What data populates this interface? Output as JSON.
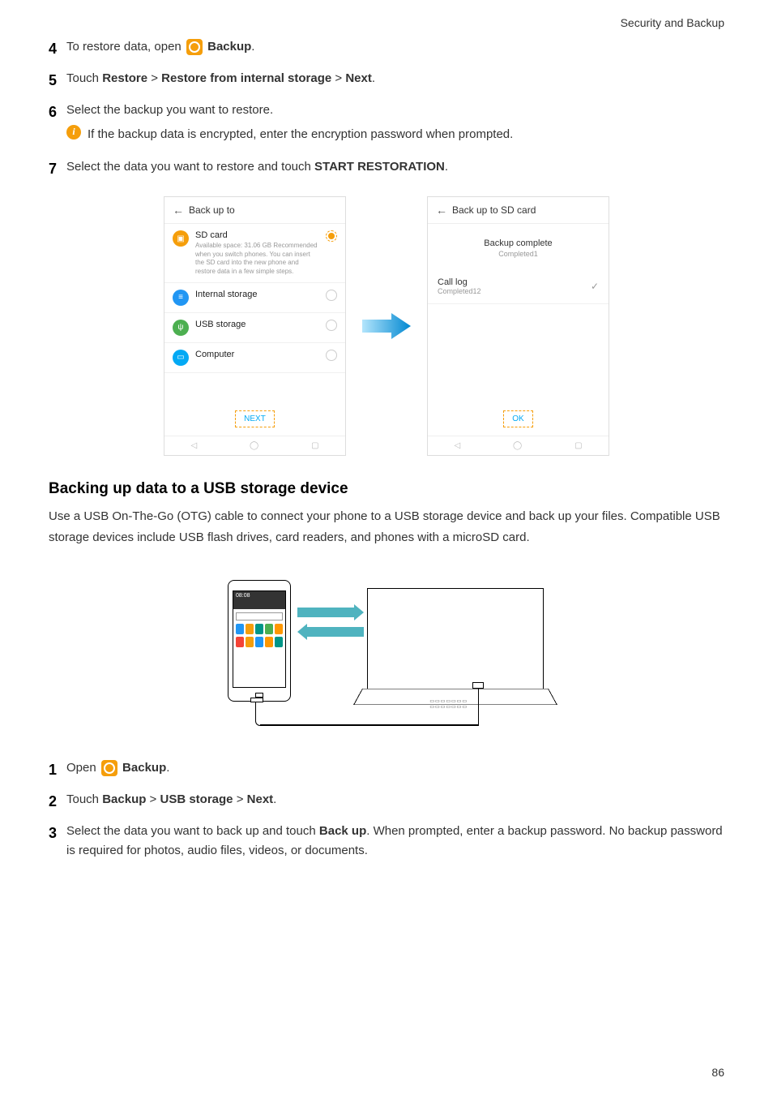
{
  "breadcrumb": "Security and Backup",
  "steps_top": [
    {
      "num": "4",
      "pre": "To restore data, open ",
      "bold_after_icon": "Backup",
      "suffix": "."
    },
    {
      "num": "5",
      "parts": [
        "Touch ",
        "Restore",
        " > ",
        "Restore from internal storage",
        " > ",
        "Next",
        "."
      ]
    },
    {
      "num": "6",
      "text": "Select the backup you want to restore.",
      "info": "If the backup data is encrypted, enter the encryption password when prompted."
    },
    {
      "num": "7",
      "parts": [
        "Select the data you want to restore and touch ",
        "START RESTORATION",
        "."
      ]
    }
  ],
  "screen_left": {
    "title": "Back up to",
    "sd": {
      "title": "SD card",
      "sub": "Available space: 31.06 GB\nRecommended when you switch phones. You can insert the SD card into the new phone and restore data in a few simple steps."
    },
    "internal": "Internal storage",
    "usb": "USB storage",
    "computer": "Computer",
    "next": "NEXT"
  },
  "screen_right": {
    "title": "Back up to SD card",
    "complete": "Backup complete",
    "complete_sub": "Completed1",
    "item": "Call log",
    "item_sub": "Completed12",
    "ok": "OK"
  },
  "section_title": "Backing up data to a USB storage device",
  "section_body": "Use a USB On-The-Go (OTG) cable to connect your phone to a USB storage device and back up your files. Compatible USB storage devices include USB flash drives, card readers, and phones with a microSD card.",
  "steps_bottom": [
    {
      "num": "1",
      "pre": "Open ",
      "bold_after_icon": "Backup",
      "suffix": "."
    },
    {
      "num": "2",
      "parts": [
        "Touch ",
        "Backup",
        " > ",
        "USB storage",
        " > ",
        "Next",
        "."
      ]
    },
    {
      "num": "3",
      "parts": [
        "Select the data you want to back up and touch ",
        "Back up",
        ". When prompted, enter a backup password. No backup password is required for photos, audio files, videos, or documents."
      ]
    }
  ],
  "page_number": "86"
}
